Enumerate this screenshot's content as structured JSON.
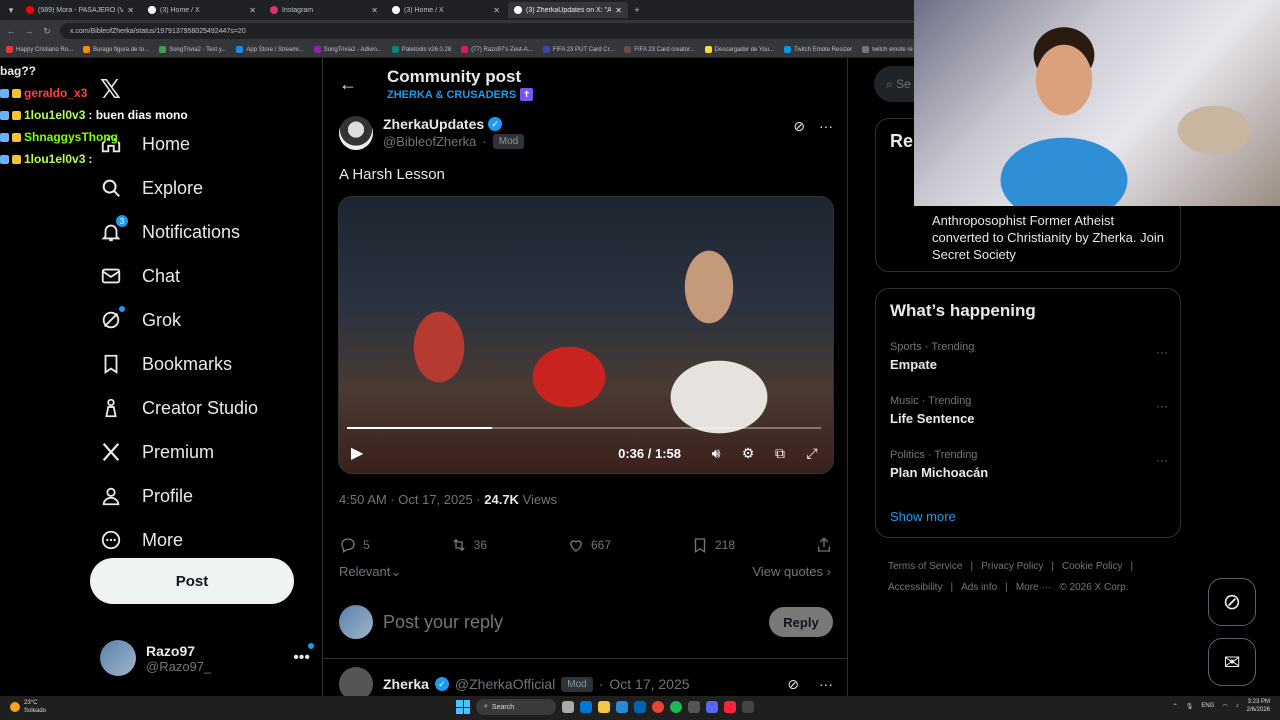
{
  "browser": {
    "tabs": [
      {
        "label": "(589) Mora - PASAJERO (Visual",
        "active": false,
        "color": "#ff0000"
      },
      {
        "label": "(3) Home / X",
        "active": false,
        "color": "#ffffff"
      },
      {
        "label": "Instagram",
        "active": false,
        "color": "#e1306c"
      },
      {
        "label": "(3) Home / X",
        "active": false,
        "color": "#ffffff"
      },
      {
        "label": "(3) ZherkaUpdates on X: \"A Ha",
        "active": true,
        "color": "#ffffff"
      }
    ],
    "url": "x.com/BibleofZherka/status/1979137958025492447s=20",
    "bookmarks": [
      "Happy Cristiano Ro...",
      "Burago figura de to...",
      "SongTrivia2 - Test y...",
      "App Store / Streami...",
      "SongTrivia2 - Adivin...",
      "Paletools v26.0.28",
      "(77) Razo97's Zest-A...",
      "FIFA 23 PUT Card Cr...",
      "FIFA 23 Card creator...",
      "Descargador de You...",
      "Twitch Emote Resizer",
      "twitch emote re"
    ]
  },
  "chat": {
    "lines": [
      {
        "user": "bag??",
        "msg": "",
        "color": "#e7e9ea"
      },
      {
        "user": "geraldo_x3",
        "msg": "",
        "color": "#ff4040"
      },
      {
        "user": "1lou1el0v3",
        "msg": ": buen dias mono",
        "color": "#b7ff4a"
      },
      {
        "user": "ShnaggysThong",
        "msg": "",
        "color": "#7fff00"
      },
      {
        "user": "1lou1el0v3",
        "msg": ":",
        "color": "#b7ff4a"
      }
    ]
  },
  "nav": {
    "items": [
      {
        "label": "Home",
        "icon": "home-icon"
      },
      {
        "label": "Explore",
        "icon": "search-icon"
      },
      {
        "label": "Notifications",
        "icon": "bell-icon",
        "badge": "3"
      },
      {
        "label": "Chat",
        "icon": "mail-icon"
      },
      {
        "label": "Grok",
        "icon": "grok-icon"
      },
      {
        "label": "Bookmarks",
        "icon": "bookmark-icon"
      },
      {
        "label": "Creator Studio",
        "icon": "creator-icon"
      },
      {
        "label": "Premium",
        "icon": "x-icon"
      },
      {
        "label": "Profile",
        "icon": "person-icon"
      },
      {
        "label": "More",
        "icon": "more-circle-icon"
      }
    ],
    "post_label": "Post",
    "account": {
      "name": "Razo97",
      "handle": "@Razo97_"
    }
  },
  "main": {
    "title": "Community post",
    "community": "ZHERKA & CRUSADERS",
    "post": {
      "name": "ZherkaUpdates",
      "handle": "@BibleofZherka",
      "dot": "·",
      "tag": "Mod",
      "text": "A Harsh Lesson",
      "video_time": "0:36 / 1:58",
      "video_progress": 0.305,
      "timestamp": "4:50 AM · Oct 17, 2025 · ",
      "views_count": "24.7K",
      "views_label": " Views",
      "stats": {
        "replies": "5",
        "reposts": "36",
        "likes": "667",
        "bookmarks": "218"
      }
    },
    "relevant_label": "Relevant",
    "view_quotes_label": "View quotes",
    "reply_placeholder": "Post your reply",
    "reply_button": "Reply",
    "next_post": {
      "name": "Zherka",
      "handle": "@ZherkaOfficial",
      "tag": "Mod",
      "date": "Oct 17, 2025"
    }
  },
  "right": {
    "search_placeholder": "Se",
    "relevant_title": "Rel",
    "bio": "Anthroposophist Former Atheist converted to Christianity by Zherka. Join Secret Society",
    "happening_title": "What’s happening",
    "trends": [
      {
        "meta": "Sports · Trending",
        "name": "Empate"
      },
      {
        "meta": "Music · Trending",
        "name": "Life Sentence"
      },
      {
        "meta": "Politics · Trending",
        "name": "Plan Michoacán"
      }
    ],
    "show_more": "Show more",
    "footer": [
      "Terms of Service",
      "|",
      "Privacy Policy",
      "|",
      "Cookie Policy",
      "|",
      "Accessibility",
      "|",
      "Ads info",
      "|",
      "More ···",
      "© 2026 X Corp."
    ]
  },
  "taskbar": {
    "weather_temp": "23°C",
    "weather_desc": "Soleado",
    "search_label": "Search",
    "lang": "ENG",
    "time": "3:23 PM",
    "date": "2/6/2026"
  }
}
